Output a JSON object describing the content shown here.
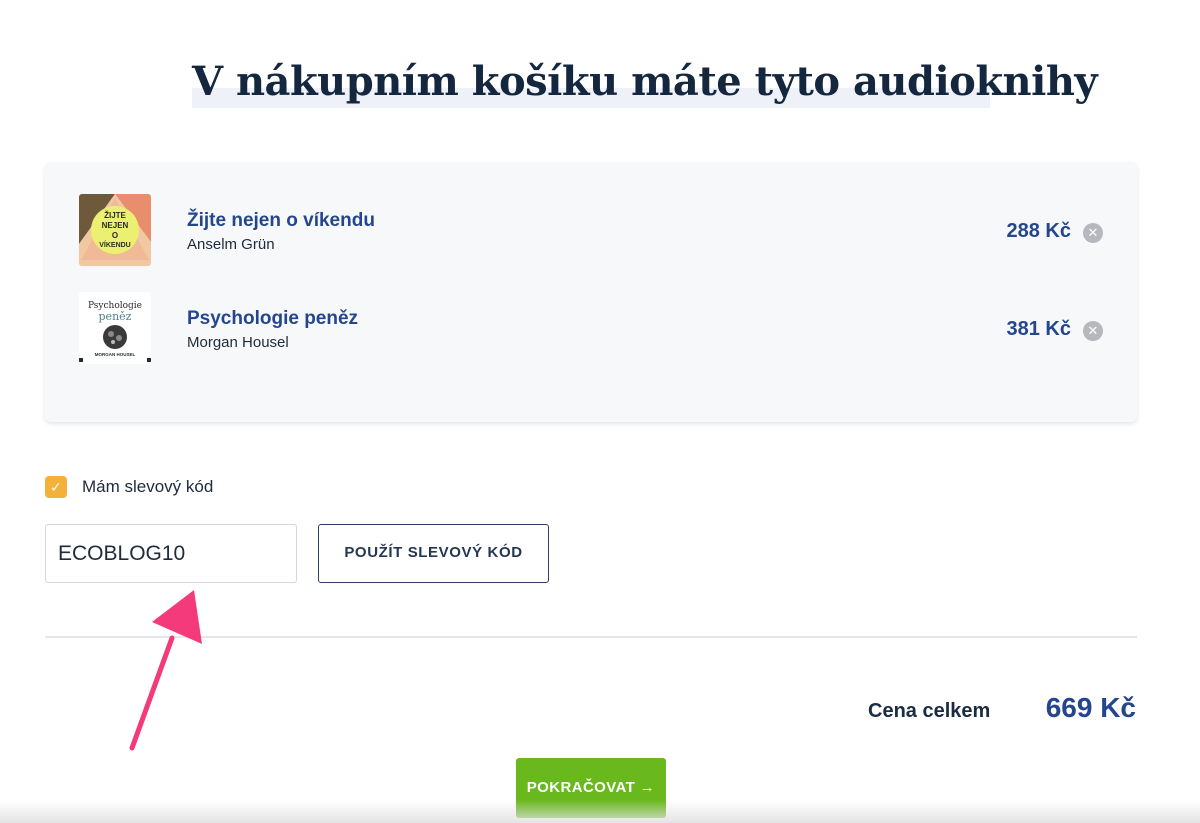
{
  "page": {
    "title": "V nákupním košíku máte tyto audioknihy"
  },
  "cart": {
    "items": [
      {
        "title": "Žijte nejen o víkendu",
        "author": "Anselm Grün",
        "price": "288 Kč",
        "cover_text": [
          "ŽIJTE",
          "NEJEN",
          "O",
          "VÍKENDU"
        ]
      },
      {
        "title": "Psychologie peněz",
        "author": "Morgan Housel",
        "price": "381 Kč",
        "cover_text": [
          "Psychologie",
          "peněz",
          "MORGAN HOUSEL"
        ]
      }
    ],
    "remove_icon": "close-circle-icon"
  },
  "discount": {
    "checkbox_checked": true,
    "checkbox_label": "Mám slevový kód",
    "code_value": "ECOBLOG10",
    "apply_label": "POUŽÍT SLEVOVÝ KÓD"
  },
  "summary": {
    "total_label": "Cena celkem",
    "total_value": "669 Kč"
  },
  "actions": {
    "continue_label": "POKRAČOVAT →"
  },
  "colors": {
    "accent_blue": "#24468e",
    "continue_green": "#69b81d",
    "checkbox_orange": "#f3b13a",
    "annotation_pink": "#f43a7b"
  }
}
